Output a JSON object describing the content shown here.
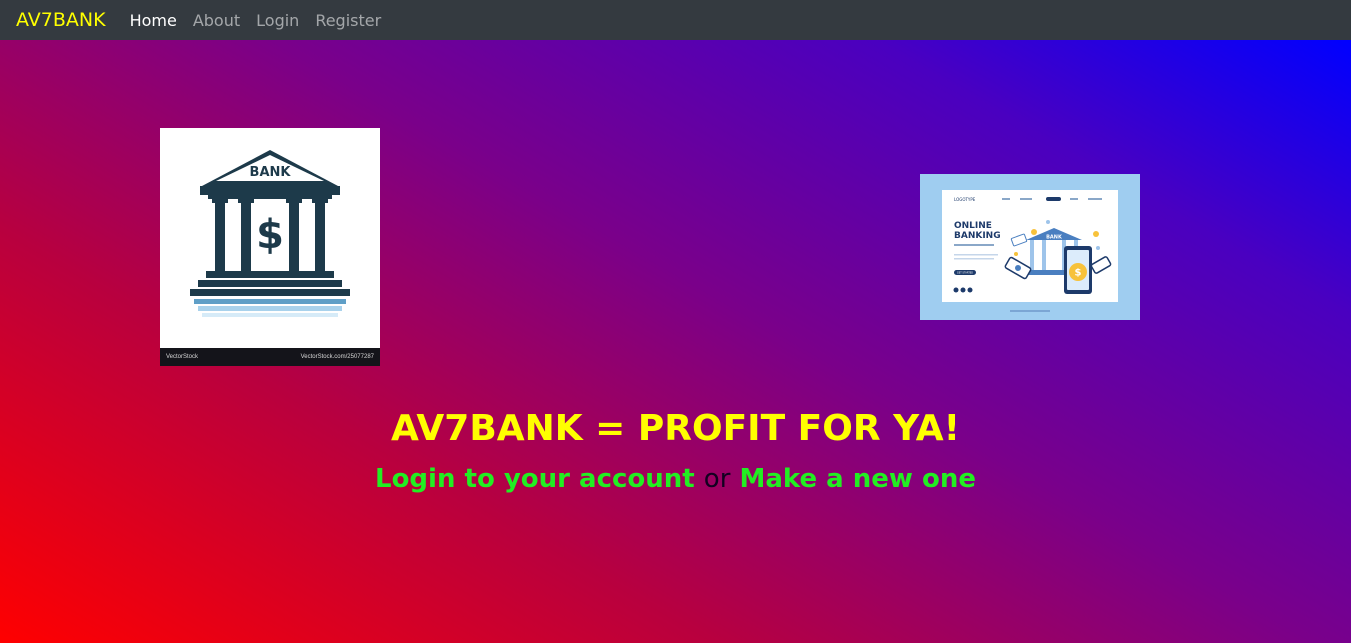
{
  "navbar": {
    "brand": "AV7BANK",
    "links": [
      {
        "label": "Home",
        "active": true
      },
      {
        "label": "About",
        "active": false
      },
      {
        "label": "Login",
        "active": false
      },
      {
        "label": "Register",
        "active": false
      }
    ]
  },
  "images": {
    "left": {
      "sign_text": "BANK",
      "symbol": "$",
      "watermark_left": "VectorStock",
      "watermark_right": "VectorStock.com/25077287"
    },
    "right": {
      "heading_line1": "ONLINE",
      "heading_line2": "BANKING",
      "logo_text": "LOGOTYPE",
      "building_sign": "BANK",
      "button_text": "GET STARTED"
    }
  },
  "hero": {
    "headline": "AV7BANK = PROFIT FOR YA!",
    "login_link": "Login to your account",
    "separator": "or",
    "register_link": "Make a new one"
  },
  "colors": {
    "brand": "#ffff00",
    "headline": "#ffff00",
    "link": "#22ee22",
    "navbar_bg": "#343a40",
    "gradient_start": "#ff0000",
    "gradient_end": "#0000ff"
  }
}
